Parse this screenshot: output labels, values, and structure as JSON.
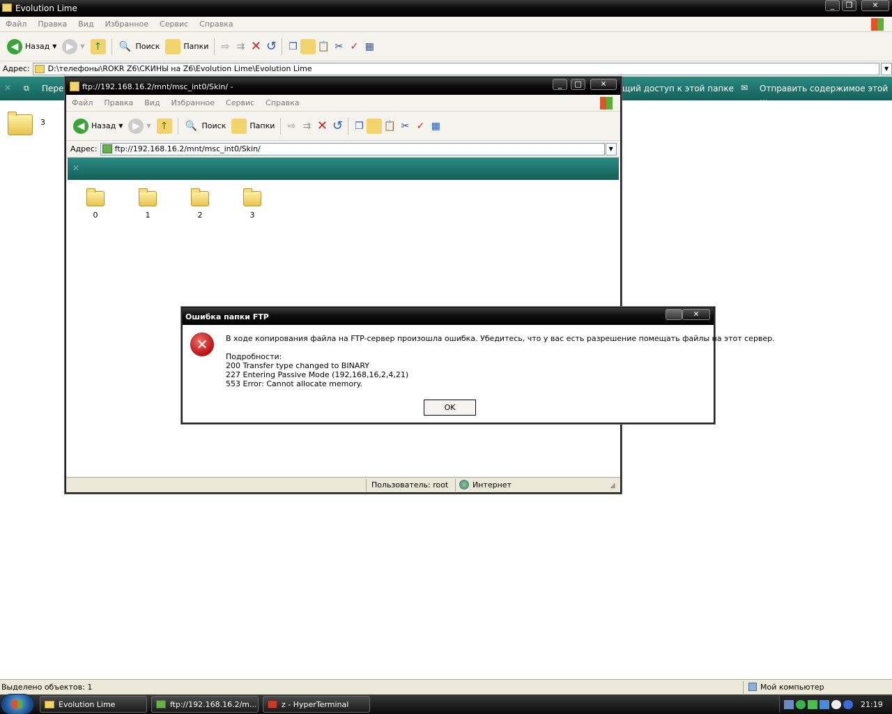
{
  "main_window": {
    "title": "Evolution Lime",
    "menu": [
      "Файл",
      "Правка",
      "Вид",
      "Избранное",
      "Сервис",
      "Справка"
    ],
    "toolbar": {
      "back": "Назад",
      "search": "Поиск",
      "folders": "Папки"
    },
    "address_label": "Адрес:",
    "address_value": "D:\\телефоны\\ROKR Z6\\СКИНЫ на Z6\\Evolution Lime\\Evolution Lime",
    "taskpane": {
      "left_text": "Пере",
      "share_text": "щий доступ к этой папке",
      "send_text": "Отправить содержимое этой ..."
    },
    "items": [
      {
        "label": "3"
      }
    ],
    "status_left": "Выделено объектов: 1",
    "status_right": "Мой компьютер"
  },
  "ftp_window": {
    "title": "ftp://192.168.16.2/mnt/msc_int0/Skin/ -",
    "menu": [
      "Файл",
      "Правка",
      "Вид",
      "Избранное",
      "Сервис",
      "Справка"
    ],
    "toolbar": {
      "back": "Назад",
      "search": "Поиск",
      "folders": "Папки"
    },
    "address_label": "Адрес:",
    "address_value": "ftp://192.168.16.2/mnt/msc_int0/Skin/",
    "folders": [
      "0",
      "1",
      "2",
      "3"
    ],
    "status_user": "Пользователь: root",
    "status_zone": "Интернет"
  },
  "dialog": {
    "title": "Ошибка папки FTP",
    "message": "В ходе копирования файла на FTP-сервер произошла ошибка. Убедитесь, что у вас есть разрешение помещать файлы на этот сервер.",
    "details_label": "Подробности:",
    "details": [
      "200 Transfer type changed to BINARY",
      "227 Entering Passive Mode (192,168,16,2,4,21)",
      "553 Error: Cannot allocate memory."
    ],
    "ok": "OK"
  },
  "taskbar": {
    "items": [
      "Evolution Lime",
      "ftp://192.168.16.2/m...",
      "z - HyperTerminal"
    ],
    "clock": "21:19"
  },
  "colors": {
    "teal_pane": "#1e7a72",
    "error_red": "#d42020"
  }
}
